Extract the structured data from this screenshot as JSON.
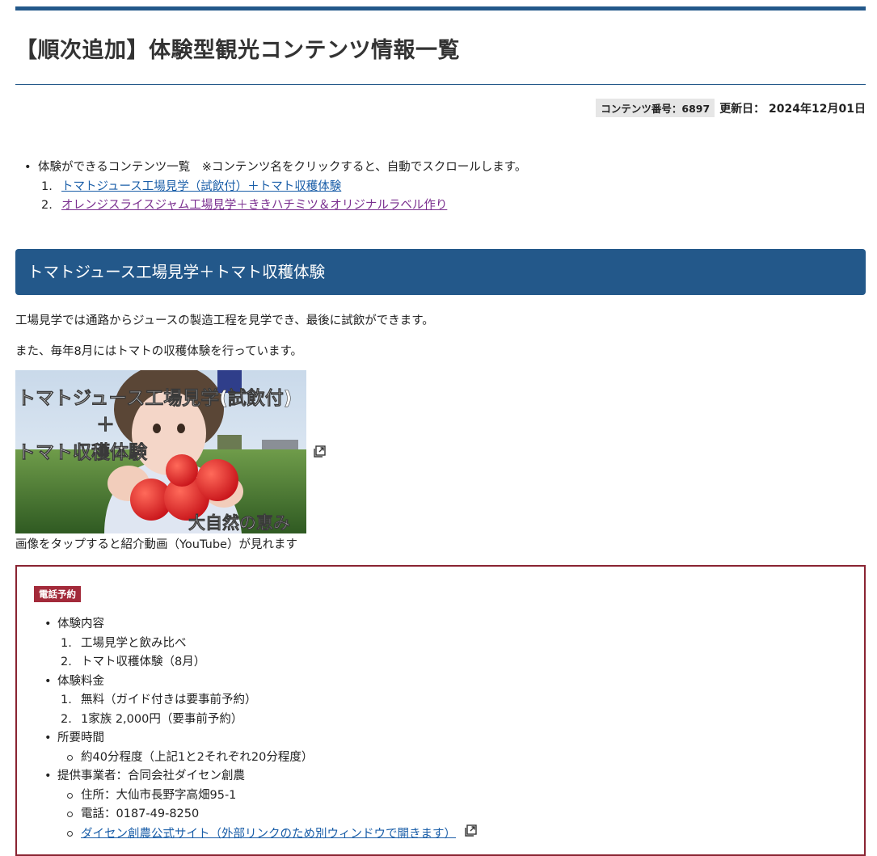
{
  "page": {
    "title": "【順次追加】体験型観光コンテンツ情報一覧",
    "content_number": "コンテンツ番号：6897",
    "updated": "更新日： 2024年12月01日"
  },
  "toc": {
    "bullet": "•",
    "intro": "体験ができるコンテンツ一覧　※コンテンツ名をクリックすると、自動でスクロールします。",
    "items": [
      {
        "num": "1.",
        "label": "トマトジュース工場見学（試飲付）＋トマト収穫体験"
      },
      {
        "num": "2.",
        "label": "オレンジスライスジャム工場見学＋ききハチミツ＆オリジナルラベル作り"
      }
    ]
  },
  "section1": {
    "heading": "トマトジュース工場見学＋トマト収穫体験",
    "para1": "工場見学では通路からジュースの製造工程を見学でき、最後に試飲ができます。",
    "para2": "また、毎年8月にはトマトの収穫体験を行っています。",
    "thumbnail": {
      "line1": "トマトジュース工場見学(試飲付)",
      "line2": "＋",
      "line3": "トマト収穫体験",
      "line4": "大自然の恵み"
    },
    "caption": "画像をタップすると紹介動画（YouTube）が見れます",
    "details": {
      "badge": "電話予約",
      "groups": [
        {
          "label": "体験内容",
          "items": [
            {
              "num": "1.",
              "text": "工場見学と飲み比べ"
            },
            {
              "num": "2.",
              "text": "トマト収穫体験（8月）"
            }
          ]
        },
        {
          "label": "体験料金",
          "items": [
            {
              "num": "1.",
              "text": "無料（ガイド付きは要事前予約）"
            },
            {
              "num": "2.",
              "text": "1家族 2,000円（要事前予約）"
            }
          ]
        },
        {
          "label": "所要時間",
          "items": [
            {
              "text": "約40分程度（上記1と2それぞれ20分程度）"
            }
          ]
        },
        {
          "label": "提供事業者：合同会社ダイセン創農",
          "items": [
            {
              "text": "住所：大仙市長野字高畑95-1"
            },
            {
              "text": "電話：0187-49-8250"
            },
            {
              "text": "ダイセン創農公式サイト（外部リンクのため別ウィンドウで開きます）"
            }
          ]
        }
      ]
    }
  },
  "colors": {
    "brand_blue": "#23588a",
    "link": "#1a5ea8",
    "visited": "#7a2f8f",
    "box_border": "#8a2432",
    "badge": "#a32a3a"
  },
  "icons": [
    "external-link-icon"
  ]
}
